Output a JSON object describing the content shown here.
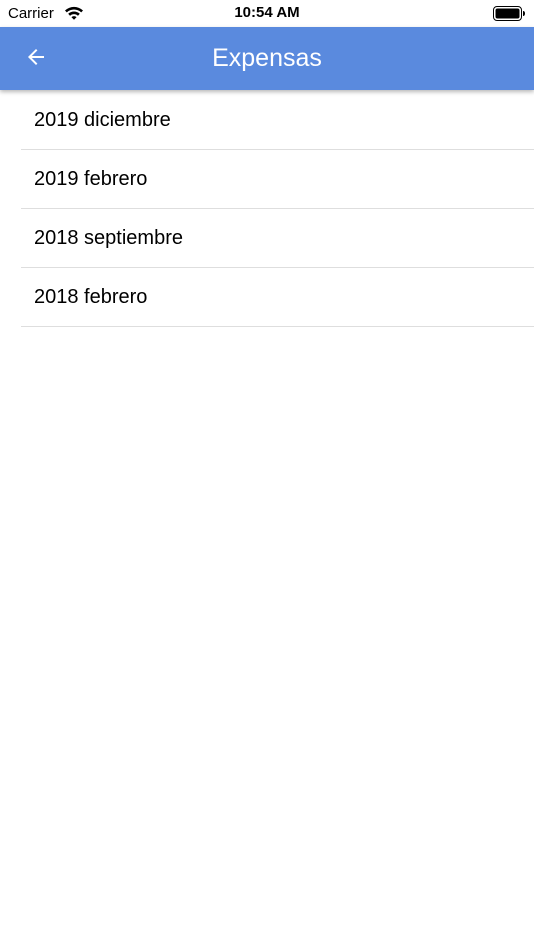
{
  "status_bar": {
    "carrier": "Carrier",
    "time": "10:54 AM",
    "wifi_icon": "wifi-icon",
    "battery_icon": "battery-full-icon"
  },
  "app_bar": {
    "title": "Expensas",
    "back_icon": "arrow-left-icon",
    "background_color": "#5a8ade",
    "text_color": "#ffffff"
  },
  "list": {
    "items": [
      {
        "label": "2019 diciembre"
      },
      {
        "label": "2019 febrero"
      },
      {
        "label": "2018 septiembre"
      },
      {
        "label": "2018 febrero"
      }
    ]
  }
}
